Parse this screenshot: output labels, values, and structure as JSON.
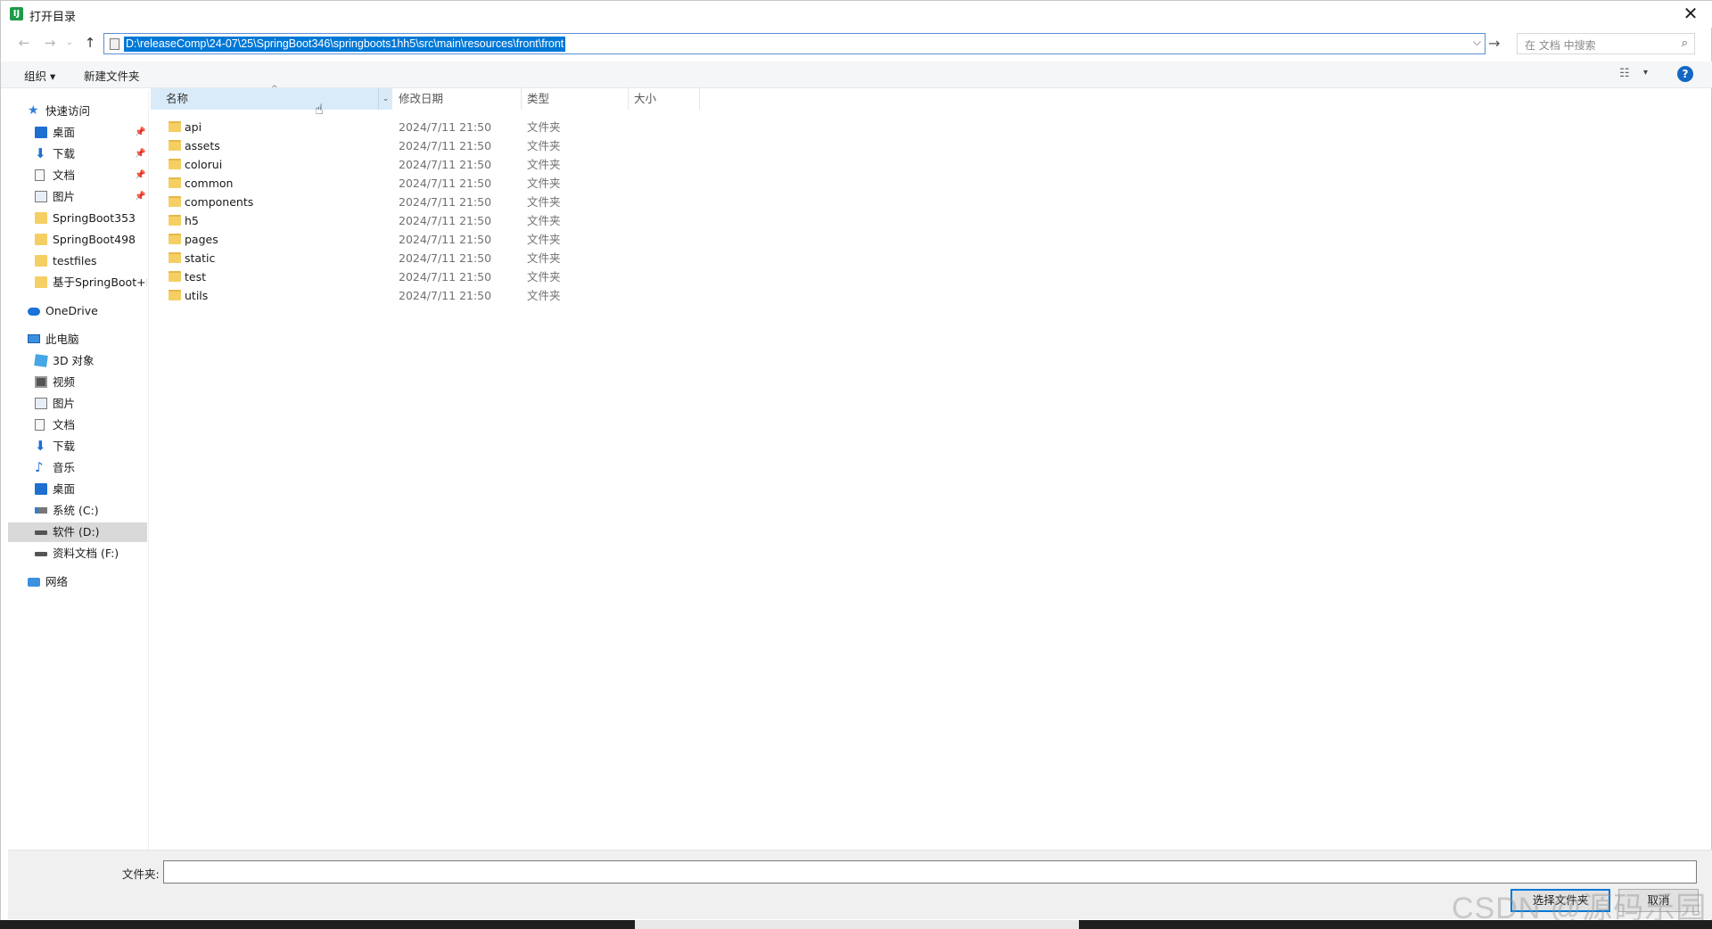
{
  "window": {
    "title": "打开目录",
    "app_icon_letter": "IJ",
    "close_glyph": "✕"
  },
  "nav": {
    "back": "←",
    "forward": "→",
    "recent": "⌄",
    "up": "↑",
    "address": "D:\\releaseComp\\24-07\\25\\SpringBoot346\\springboots1hh5\\src\\main\\resources\\front\\front",
    "address_dropdown": "⌵",
    "go": "→",
    "search_placeholder": "在 文档 中搜索",
    "search_icon": "⌕"
  },
  "toolbar": {
    "organize": "组织 ▾",
    "new_folder": "新建文件夹",
    "view_icon": "☷",
    "view_dropdown": "▾",
    "help": "?"
  },
  "sidebar": {
    "pin_glyph": "📌",
    "items": [
      {
        "label": "快速访问",
        "icon": "star-icon",
        "glyph": "★"
      },
      {
        "label": "桌面",
        "icon": "desktop-icon",
        "pinned": true
      },
      {
        "label": "下载",
        "icon": "download-icon",
        "glyph": "⬇",
        "pinned": true
      },
      {
        "label": "文档",
        "icon": "document-icon",
        "pinned": true
      },
      {
        "label": "图片",
        "icon": "pictures-icon",
        "pinned": true
      },
      {
        "label": "SpringBoot353",
        "icon": "folder-icon"
      },
      {
        "label": "SpringBoot498",
        "icon": "folder-icon"
      },
      {
        "label": "testfiles",
        "icon": "folder-icon"
      },
      {
        "label": "基于SpringBoot+N",
        "icon": "folder-icon"
      },
      {
        "label": "OneDrive",
        "icon": "onedrive-icon"
      },
      {
        "label": "此电脑",
        "icon": "computer-icon"
      },
      {
        "label": "3D 对象",
        "icon": "3d-objects-icon"
      },
      {
        "label": "视频",
        "icon": "video-icon"
      },
      {
        "label": "图片",
        "icon": "pictures-icon"
      },
      {
        "label": "文档",
        "icon": "document-icon"
      },
      {
        "label": "下载",
        "icon": "download-icon",
        "glyph": "⬇"
      },
      {
        "label": "音乐",
        "icon": "music-icon",
        "glyph": "♪"
      },
      {
        "label": "桌面",
        "icon": "desktop-icon"
      },
      {
        "label": "系统 (C:)",
        "icon": "system-drive-icon"
      },
      {
        "label": "软件 (D:)",
        "icon": "drive-icon",
        "selected": true
      },
      {
        "label": "资料文档 (F:)",
        "icon": "drive-icon"
      },
      {
        "label": "网络",
        "icon": "network-icon"
      }
    ]
  },
  "columns": {
    "name": "名称",
    "modified": "修改日期",
    "type": "类型",
    "size": "大小",
    "sort_arrow": "^",
    "split_arrow": "⌄"
  },
  "files": [
    {
      "name": "api",
      "modified": "2024/7/11 21:50",
      "type": "文件夹"
    },
    {
      "name": "assets",
      "modified": "2024/7/11 21:50",
      "type": "文件夹"
    },
    {
      "name": "colorui",
      "modified": "2024/7/11 21:50",
      "type": "文件夹"
    },
    {
      "name": "common",
      "modified": "2024/7/11 21:50",
      "type": "文件夹"
    },
    {
      "name": "components",
      "modified": "2024/7/11 21:50",
      "type": "文件夹"
    },
    {
      "name": "h5",
      "modified": "2024/7/11 21:50",
      "type": "文件夹"
    },
    {
      "name": "pages",
      "modified": "2024/7/11 21:50",
      "type": "文件夹"
    },
    {
      "name": "static",
      "modified": "2024/7/11 21:50",
      "type": "文件夹"
    },
    {
      "name": "test",
      "modified": "2024/7/11 21:50",
      "type": "文件夹"
    },
    {
      "name": "utils",
      "modified": "2024/7/11 21:50",
      "type": "文件夹"
    }
  ],
  "footer": {
    "filename_label": "文件夹:",
    "filename_value": "",
    "select_button": "选择文件夹",
    "cancel_button": "取消"
  },
  "watermark": "CSDN @源码乐园",
  "colors": {
    "accent": "#0078d7",
    "selection": "#0078d7",
    "folder": "#f5cf63",
    "sorted_header": "#d9ebf9"
  }
}
